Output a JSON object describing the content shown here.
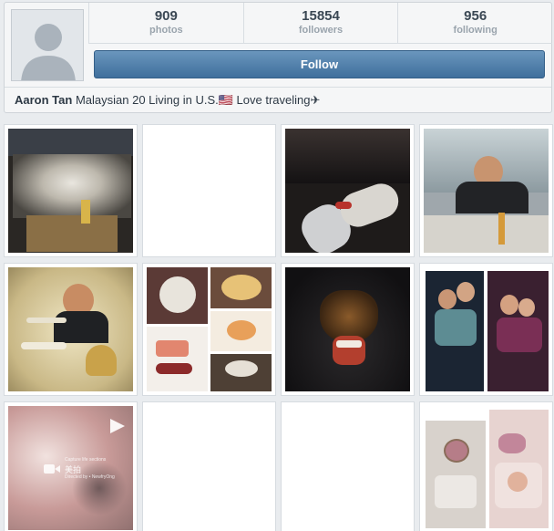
{
  "profile": {
    "name": "Aaron Tan",
    "bio": "Malaysian 20 Living in U.S.🇺🇸 Love traveling✈",
    "avatar_icon": "default-avatar-icon"
  },
  "stats": {
    "photos": {
      "value": "909",
      "label": "photos"
    },
    "followers": {
      "value": "15854",
      "label": "followers"
    },
    "following": {
      "value": "956",
      "label": "following"
    }
  },
  "actions": {
    "follow_label": "Follow"
  },
  "colors": {
    "follow_button": "#4f7fad",
    "background": "#e9ecef"
  },
  "grid": {
    "video_overlay": {
      "play_icon": "play-icon",
      "caption_line1": "Capture life sections",
      "caption_app": "美拍",
      "caption_line3": "Directed by • NewfryOng"
    }
  }
}
